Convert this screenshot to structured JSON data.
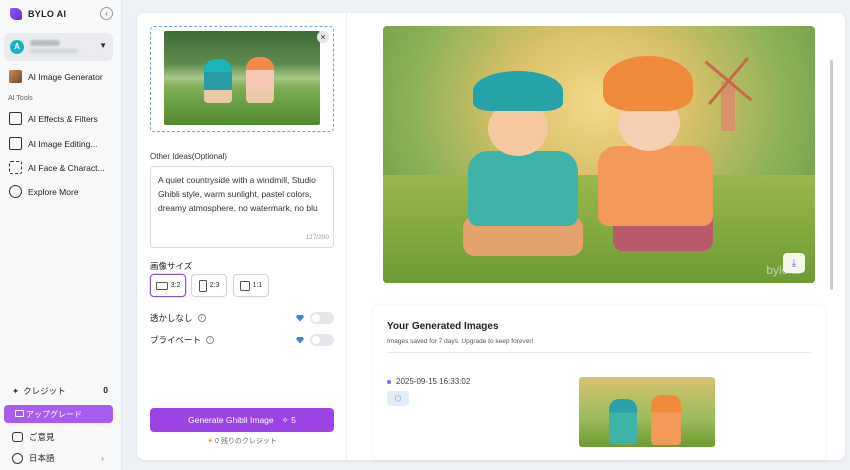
{
  "brand": {
    "name": "BYLO AI"
  },
  "sidebar": {
    "collapse_icon": "chevron-left-icon",
    "user_avatar_letter": "A",
    "ai_image_generator": "AI Image Generator",
    "section_label": "AI Tools",
    "items": [
      {
        "label": "AI Effects & Filters",
        "icon": "sliders-icon"
      },
      {
        "label": "AI Image Editing...",
        "icon": "edit-icon"
      },
      {
        "label": "AI Face & Charact...",
        "icon": "face-scan-icon"
      },
      {
        "label": "Explore More",
        "icon": "compass-icon"
      }
    ],
    "credits_label": "クレジット",
    "credits_value": "0",
    "upgrade_label": "アップグレード",
    "feedback_label": "ご意見",
    "language_label": "日本語"
  },
  "form": {
    "other_ideas_label": "Other Ideas(Optional)",
    "prompt_text": "A quiet countryside with a windmill, Studio Ghibli style, warm sunlight, pastel colors, dreamy atmosphere, no watermark, no blu",
    "char_count": "127/200",
    "size_label": "画像サイズ",
    "sizes": [
      {
        "label": "3:2",
        "selected": true
      },
      {
        "label": "2:3",
        "selected": false
      },
      {
        "label": "1:1",
        "selected": false
      }
    ],
    "no_watermark_label": "透かしなし",
    "private_label": "プライベート",
    "generate_label": "Generate Ghibli Image",
    "generate_cost": "5",
    "remaining_credits": "0 残りのクレジット"
  },
  "result": {
    "watermark": "bylo.ai"
  },
  "gallery": {
    "title": "Your Generated Images",
    "subtitle": "Images saved for 7 days. Upgrade to keep forever!",
    "entries": [
      {
        "timestamp": "2025-09-15 16:33:02"
      }
    ]
  },
  "colors": {
    "accent": "#9b43e4",
    "upload_border": "#6ea3e0"
  }
}
